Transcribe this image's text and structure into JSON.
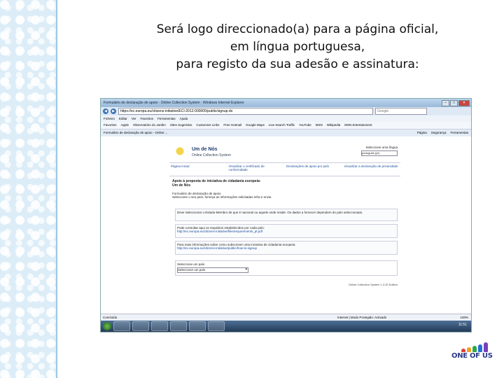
{
  "slide": {
    "caption": [
      "Será logo direccionado(a) para a página oficial,",
      "em língua portuguesa,",
      "para registo da sua adesão e assinatura:"
    ],
    "brand_logo": "ONE OF US"
  },
  "browser": {
    "window_title": "Formulário de declaração de apoio - Online Collection System - Windows Internet Explorer",
    "address": "https://ec.europa.eu/citizens-initiative/ECI-2012-000005/public/signup.do",
    "search_placeholder": "Google",
    "menu": [
      "Ficheiro",
      "Editar",
      "Ver",
      "Favoritos",
      "Ferramentas",
      "Ajuda"
    ],
    "favorites": [
      "Favoritos",
      "Apple",
      "Observatório do Jardim",
      "Sites Sugeridos",
      "Customize Links",
      "Free Hotmail",
      "Google Maps",
      "Live Search Traffic",
      "YouTube",
      "MSN",
      "Wikipedia",
      "MSN Entertainment"
    ],
    "tab_title": "Formulário de declaração de apoio - Online ...",
    "tab_tools": [
      "Página",
      "Segurança",
      "Ferramentas"
    ],
    "status_left": "Concluído",
    "status_zone": "Internet | Modo Protegido: Activado",
    "zoom": "100%",
    "clock": "11:51"
  },
  "page": {
    "org_name": "Um de Nós",
    "org_subtitle": "Online Collection System",
    "language_label": "Seleccione uma língua",
    "language_value": "português (pt)",
    "nav": [
      "Página inicial",
      "Visualizar o certificado de conformidade",
      "Declarações de apoio por país",
      "Visualizar a declaração de privacidade"
    ],
    "title_lines": [
      "Apoie à proposta de iniciativa de cidadania europeia:",
      "Um de Nós"
    ],
    "form_lines": [
      "Formulário de declaração de apoio",
      "Seleccione o seu país, forneça as informações solicitadas infra e envie."
    ],
    "box1": "Deve Seleccionar o Estado-Membro de que é nacional ou aquele onde reside. Os dados a fornecer dependem do país seleccionado.",
    "box2_text": "Pode consultar aqui os requisitos estabelecidos por cada país:",
    "box2_link": "http://ec.europa.eu/citizens-initiative/files/requirements_pt.pdf",
    "box3_text": "Para mais informações sobre como subscrever uma iniciativa de cidadania europeia:",
    "box3_link": "http://ec.europa.eu/citizens-initiative/public/how-to-signup",
    "country_label": "Seleccione um país",
    "country_value": "Seleccione um país",
    "version": "Online Collection System 1.3.20 Edition"
  }
}
